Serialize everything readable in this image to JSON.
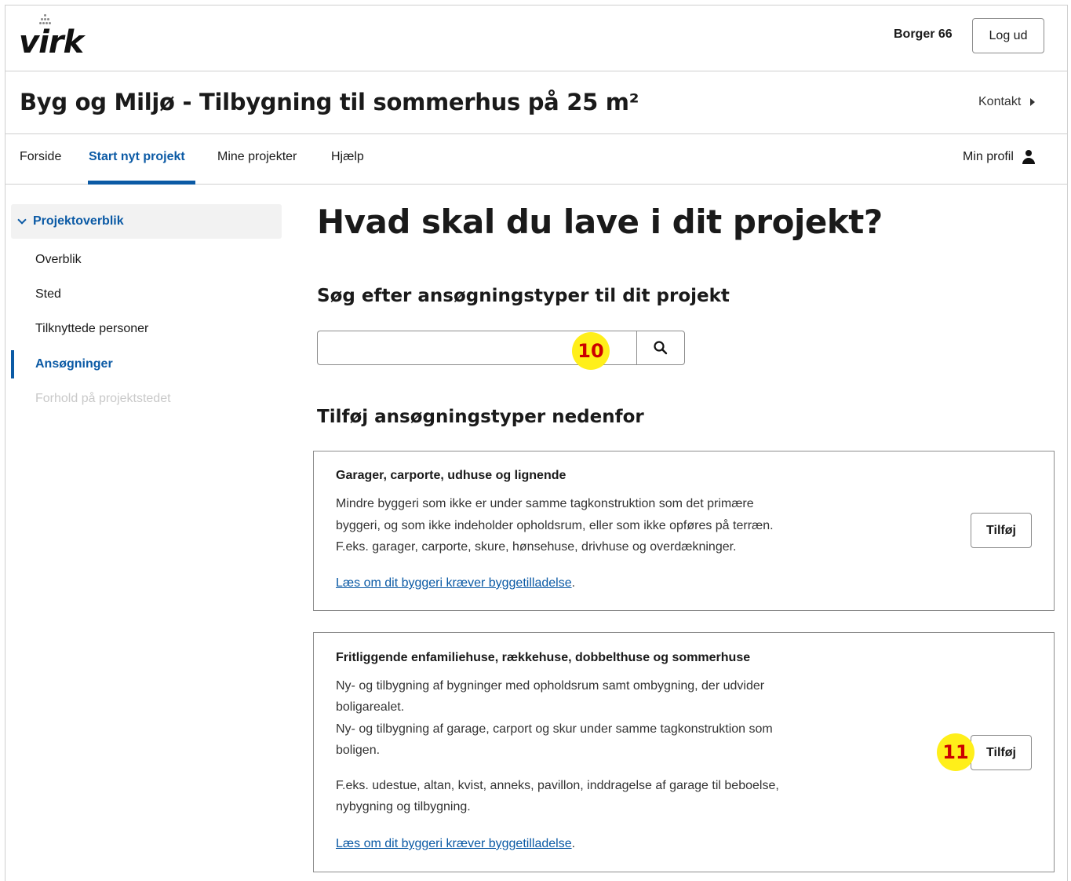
{
  "header": {
    "logo_text": "virk",
    "user_name": "Borger 66",
    "logout_label": "Log ud"
  },
  "title_bar": {
    "title": "Byg og Miljø - Tilbygning til sommerhus på 25 m²",
    "contact_label": "Kontakt"
  },
  "nav": {
    "items": [
      {
        "label": "Forside"
      },
      {
        "label": "Start nyt projekt",
        "active": true
      },
      {
        "label": "Mine projekter"
      },
      {
        "label": "Hjælp"
      }
    ],
    "profile_label": "Min profil"
  },
  "sidebar": {
    "header": "Projektoverblik",
    "items": [
      {
        "label": "Overblik"
      },
      {
        "label": "Sted"
      },
      {
        "label": "Tilknyttede personer"
      },
      {
        "label": "Ansøgninger",
        "active": true
      },
      {
        "label": "Forhold på projektstedet",
        "disabled": true
      }
    ]
  },
  "main": {
    "heading": "Hvad skal du lave i dit projekt?",
    "search_heading": "Søg efter ansøgningstyper til dit projekt",
    "search_value": "",
    "add_heading": "Tilføj ansøgningstyper nedenfor",
    "cards": [
      {
        "title": "Garager, carporte, udhuse og lignende",
        "lines": [
          "Mindre byggeri som ikke er under samme tagkonstruktion som det primære",
          "byggeri, og som ikke indeholder opholdsrum, eller som ikke opføres på terræn.",
          "F.eks. garager, carporte, skure, hønsehuse, drivhuse og overdækninger."
        ],
        "link_text": "Læs om dit byggeri kræver byggetilladelse",
        "link_suffix": ".",
        "button_label": "Tilføj"
      },
      {
        "title": "Fritliggende enfamiliehuse, rækkehuse, dobbelthuse og sommerhuse",
        "lines": [
          "Ny- og tilbygning af bygninger med opholdsrum samt ombygning, der udvider",
          "boligarealet.",
          "Ny- og tilbygning af garage, carport og skur under samme tagkonstruktion som",
          "boligen.",
          "F.eks. udestue, altan, kvist, anneks, pavillon, inddragelse af garage til beboelse,",
          "nybygning og tilbygning."
        ],
        "link_text": "Læs om dit byggeri kræver byggetilladelse",
        "link_suffix": ".",
        "button_label": "Tilføj"
      }
    ]
  },
  "annotations": {
    "badge_search": "10",
    "badge_add": "11",
    "badge_color": "#ffef1a",
    "badge_text_color": "#cc0000"
  },
  "colors": {
    "accent": "#0b5aa5",
    "border": "#cfcfcf"
  }
}
